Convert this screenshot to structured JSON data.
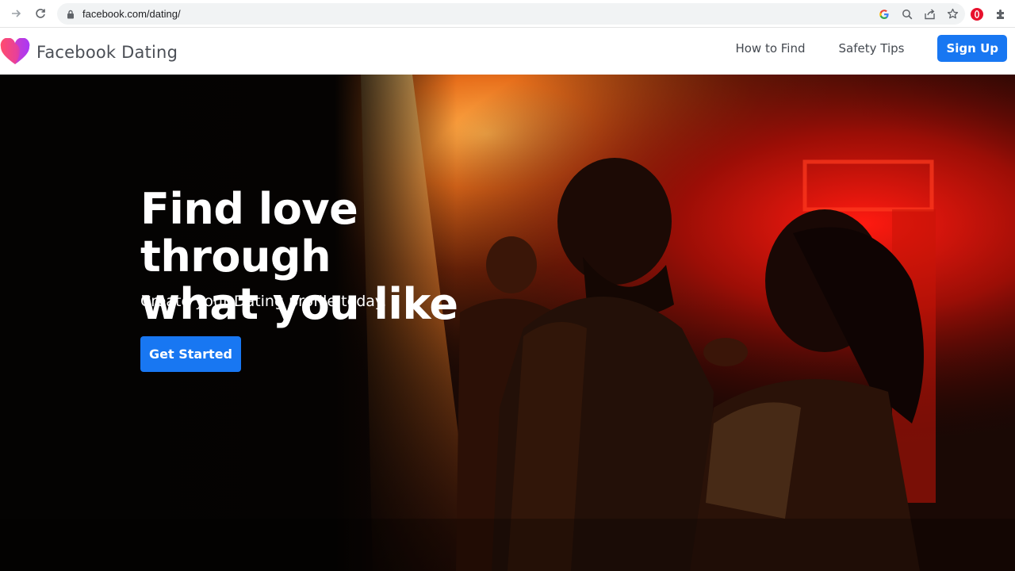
{
  "browser": {
    "url": "facebook.com/dating/",
    "icons": [
      "forward-icon",
      "reload-icon",
      "lock-icon",
      "google-icon",
      "zoom-icon",
      "share-icon",
      "star-icon",
      "opera-icon",
      "extensions-icon"
    ]
  },
  "header": {
    "brand_name": "Facebook Dating",
    "nav": {
      "how_to_find": "How to Find",
      "safety_tips": "Safety Tips",
      "sign_up": "Sign Up"
    }
  },
  "hero": {
    "title_line1": "Find love through",
    "title_line2": "what you like",
    "subtitle": "Create your Dating profile today.",
    "cta": "Get Started"
  },
  "colors": {
    "accent": "#1877f2",
    "logo_pink": "#f0436b",
    "logo_purple": "#a033ff"
  }
}
